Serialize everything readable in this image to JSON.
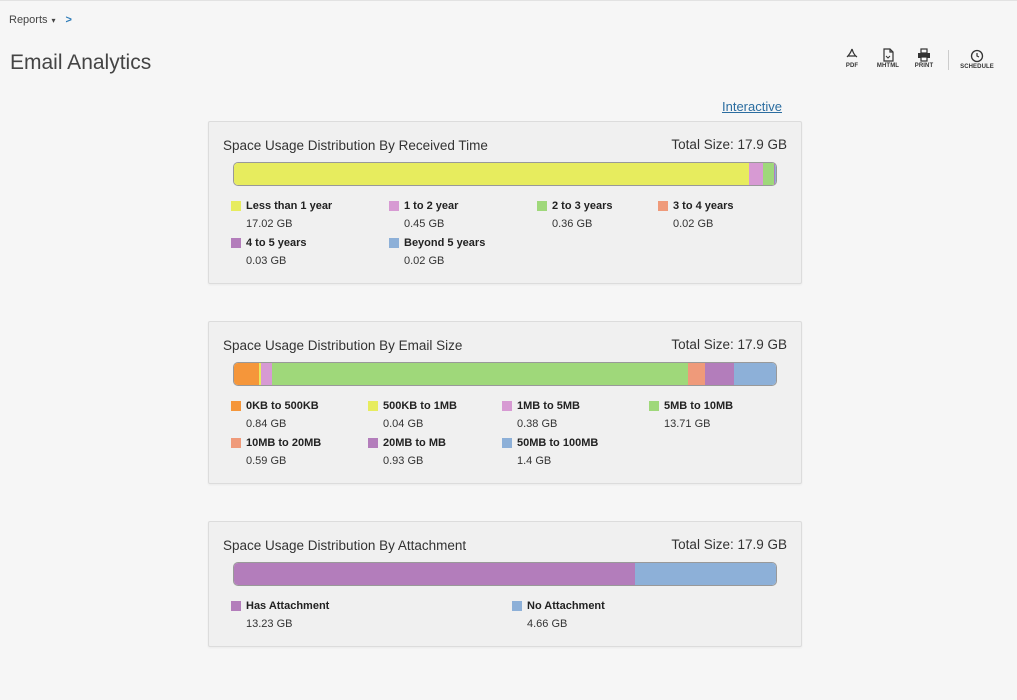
{
  "breadcrumb": {
    "root": "Reports",
    "caret": "▾",
    "separator": ">"
  },
  "page": {
    "title": "Email Analytics"
  },
  "toolbar": {
    "items": [
      {
        "id": "pdf",
        "label": "PDF",
        "icon": "pdf-icon"
      },
      {
        "id": "mhtml",
        "label": "MHTML",
        "icon": "mhtml-icon"
      },
      {
        "id": "print",
        "label": "PRINT",
        "icon": "print-icon"
      },
      {
        "id": "schedule",
        "label": "SCHEDULE",
        "icon": "clock-icon"
      }
    ]
  },
  "interactive_link": "Interactive",
  "total_prefix": "Total Size:",
  "panels": [
    {
      "title": "Space Usage Distribution By Received Time",
      "total": "17.9 GB",
      "legend": [
        {
          "label": "Less than 1 year",
          "value": "17.02 GB",
          "gb": 17.02,
          "color": "#e7ec5e"
        },
        {
          "label": "1 to 2 year",
          "value": "0.45 GB",
          "gb": 0.45,
          "color": "#d79ad3"
        },
        {
          "label": "2 to 3 years",
          "value": "0.36 GB",
          "gb": 0.36,
          "color": "#9fd87a"
        },
        {
          "label": "3 to 4 years",
          "value": "0.02 GB",
          "gb": 0.02,
          "color": "#ef9a7a"
        },
        {
          "label": "4 to 5 years",
          "value": "0.03 GB",
          "gb": 0.03,
          "color": "#b37dbb"
        },
        {
          "label": "Beyond 5 years",
          "value": "0.02 GB",
          "gb": 0.02,
          "color": "#8db0d8"
        }
      ]
    },
    {
      "title": "Space Usage Distribution By Email Size",
      "total": "17.9 GB",
      "legend": [
        {
          "label": "0KB to 500KB",
          "value": "0.84 GB",
          "gb": 0.84,
          "color": "#f5963a"
        },
        {
          "label": "500KB to 1MB",
          "value": "0.04 GB",
          "gb": 0.04,
          "color": "#e7ec5e"
        },
        {
          "label": "1MB to 5MB",
          "value": "0.38 GB",
          "gb": 0.38,
          "color": "#d79ad3"
        },
        {
          "label": "5MB to 10MB",
          "value": "13.71 GB",
          "gb": 13.71,
          "color": "#9fd87a"
        },
        {
          "label": "10MB to 20MB",
          "value": "0.59 GB",
          "gb": 0.59,
          "color": "#ef9a7a"
        },
        {
          "label": "20MB to MB",
          "value": "0.93 GB",
          "gb": 0.93,
          "color": "#b37dbb"
        },
        {
          "label": "50MB to 100MB",
          "value": "1.4 GB",
          "gb": 1.4,
          "color": "#8db0d8"
        }
      ]
    },
    {
      "title": "Space Usage Distribution By Attachment",
      "total": "17.9 GB",
      "legend": [
        {
          "label": "Has Attachment",
          "value": "13.23 GB",
          "gb": 13.23,
          "color": "#b37dbb"
        },
        {
          "label": "No Attachment",
          "value": "4.66 GB",
          "gb": 4.66,
          "color": "#8db0d8"
        }
      ]
    }
  ]
}
